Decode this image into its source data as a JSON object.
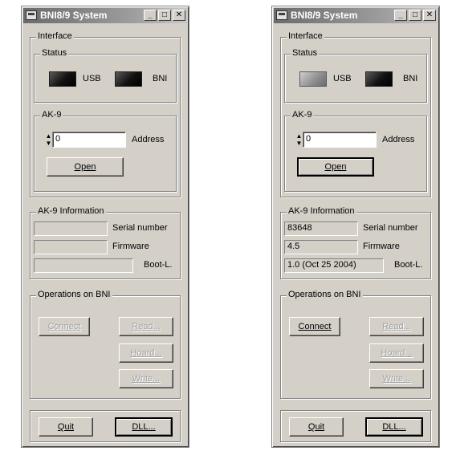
{
  "windows": [
    {
      "title": "BNI8/9 System",
      "interface_label": "Interface",
      "status_label": "Status",
      "usb_label": "USB",
      "bni_label": "BNI",
      "ak9_label": "AK-9",
      "address_value": "0",
      "address_label": "Address",
      "open_label": "Open",
      "info_label": "AK-9 Information",
      "serial_value": "",
      "serial_label": "Serial number",
      "firmware_value": "",
      "firmware_label": "Firmware",
      "bootloader_value": "",
      "bootloader_label": "Boot-L.",
      "operations_label": "Operations on BNI",
      "connect_label": "Connect",
      "read_label": "Read...",
      "hoard_label": "Hoard...",
      "write_label": "Write...",
      "quit_label": "Quit",
      "dll_label": "DLL..."
    },
    {
      "title": "BNI8/9 System",
      "interface_label": "Interface",
      "status_label": "Status",
      "usb_label": "USB",
      "bni_label": "BNI",
      "ak9_label": "AK-9",
      "address_value": "0",
      "address_label": "Address",
      "open_label": "Open",
      "info_label": "AK-9 Information",
      "serial_value": "83648",
      "serial_label": "Serial number",
      "firmware_value": "4.5",
      "firmware_label": "Firmware",
      "bootloader_value": "1.0 (Oct 25 2004)",
      "bootloader_label": "Boot-L.",
      "operations_label": "Operations on BNI",
      "connect_label": "Connect",
      "read_label": "Read...",
      "hoard_label": "Hoard...",
      "write_label": "Write...",
      "quit_label": "Quit",
      "dll_label": "DLL..."
    }
  ],
  "colors": {
    "face": "#d4d0c8",
    "led_off": "#111111",
    "led_on": "#9a9a9a"
  }
}
